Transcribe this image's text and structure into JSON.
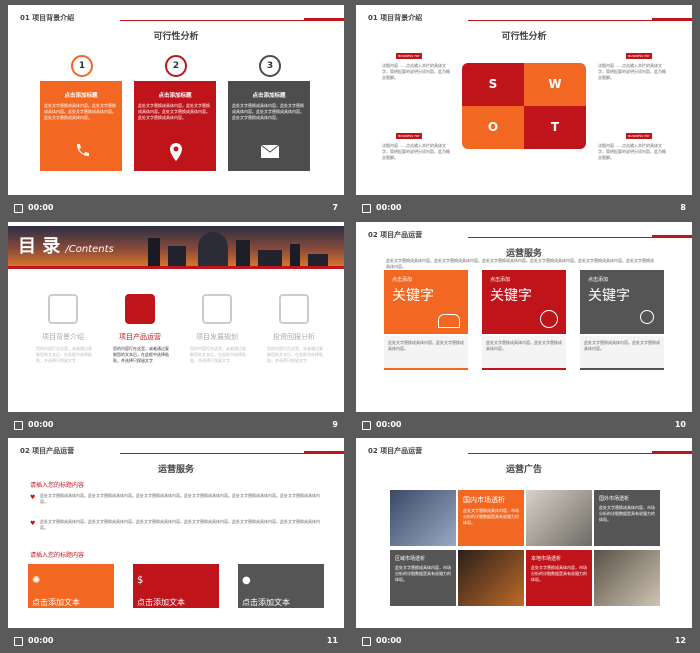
{
  "footer": {
    "time": "00:00",
    "pages": [
      "7",
      "8",
      "9",
      "10",
      "11",
      "12"
    ]
  },
  "s7": {
    "section": "01 项目背景介绍",
    "title": "可行性分析",
    "cards": [
      {
        "num": "1",
        "head": "点击添加标题",
        "body": "此处文字替换成具体内容。此处文字替换成具体内容。此处文字替换成具体内容。此处文字替换成具体内容。"
      },
      {
        "num": "2",
        "head": "点击添加标题",
        "body": "此处文字替换成具体内容。此处文字替换成具体内容。此处文字替换成具体内容。此处文字替换成具体内容。"
      },
      {
        "num": "3",
        "head": "点击添加标题",
        "body": "此处文字替换成具体内容。此处文字替换成具体内容。此处文字替换成具体内容。此处文字替换成具体内容。"
      }
    ]
  },
  "s8": {
    "section": "01 项目背景介绍",
    "title": "可行性分析",
    "swot": [
      "S",
      "W",
      "O",
      "T"
    ],
    "tag": "BUSINESS TRY",
    "text": "详细内容……点击输入本栏的具体文字，简明扼要的说明分项内容，此为概念图解。"
  },
  "s9": {
    "title": "目 录",
    "sub": "/Contents",
    "items": [
      {
        "label": "项目背景介绍",
        "desc": "您的内容打在这里，或者通过复制您的文本后，在此框中选择粘贴，并选择只保留文字"
      },
      {
        "label": "项目产品运营",
        "desc": "您的内容打在这里，或者通过复制您的文本后，在此框中选择粘贴，并选择只保留文字"
      },
      {
        "label": "项目发展规划",
        "desc": "您的内容打在这里，或者通过复制您的文本后，在此框中选择粘贴，并选择只保留文字"
      },
      {
        "label": "投资回报分析",
        "desc": "您的内容打在这里，或者通过复制您的文本后，在此框中选择粘贴，并选择只保留文字"
      }
    ]
  },
  "s10": {
    "section": "02 项目产品运营",
    "title": "运营服务",
    "intro": "此处文字替换成具体内容。此处文字替换成具体内容。此处文字替换成具体内容。此处文字替换成具体内容。此处文字替换成具体内容。此处文字替换成具体内容。",
    "boxes": [
      {
        "small": "点击添加",
        "big": "关键字",
        "text": "此处文字替换成具体内容。此处文字替换成具体内容。"
      },
      {
        "small": "点击添加",
        "big": "关键字",
        "text": "此处文字替换成具体内容。此处文字替换成具体内容。"
      },
      {
        "small": "点击添加",
        "big": "关键字",
        "text": "此处文字替换成具体内容。此处文字替换成具体内容。"
      }
    ]
  },
  "s11": {
    "section": "02 项目产品运营",
    "title": "运营服务",
    "h1": "请插入您的标题内容",
    "h2": "请插入您的标题内容",
    "p": "此处文字替换成具体内容。此处文字替换成具体内容。此处文字替换成具体内容。此处文字替换成具体内容。此处文字替换成具体内容。此处文字替换成具体内容。",
    "btns": [
      "点击添加文本",
      "点击添加文本",
      "点击添加文本"
    ]
  },
  "s12": {
    "section": "02 项目产品运营",
    "title": "运营广告",
    "boxes": [
      {
        "t": "国内市场透析",
        "d": "此处文字替换成具体内容，市场分析的详细数据是具有说服力的体现。"
      },
      {
        "t": "国外市场透析",
        "d": "此处文字替换成具体内容，市场分析的详细数据是具有说服力的体现。"
      },
      {
        "t": "区域市场透析",
        "d": "此处文字替换成具体内容，市场分析的详细数据是具有说服力的体现。"
      },
      {
        "t": "本地市场透析",
        "d": "此处文字替换成具体内容，市场分析的详细数据是具有说服力的体现。"
      }
    ]
  },
  "colors": {
    "orange": "#f26722",
    "red": "#c0141b",
    "gray": "#4d4d4d"
  }
}
